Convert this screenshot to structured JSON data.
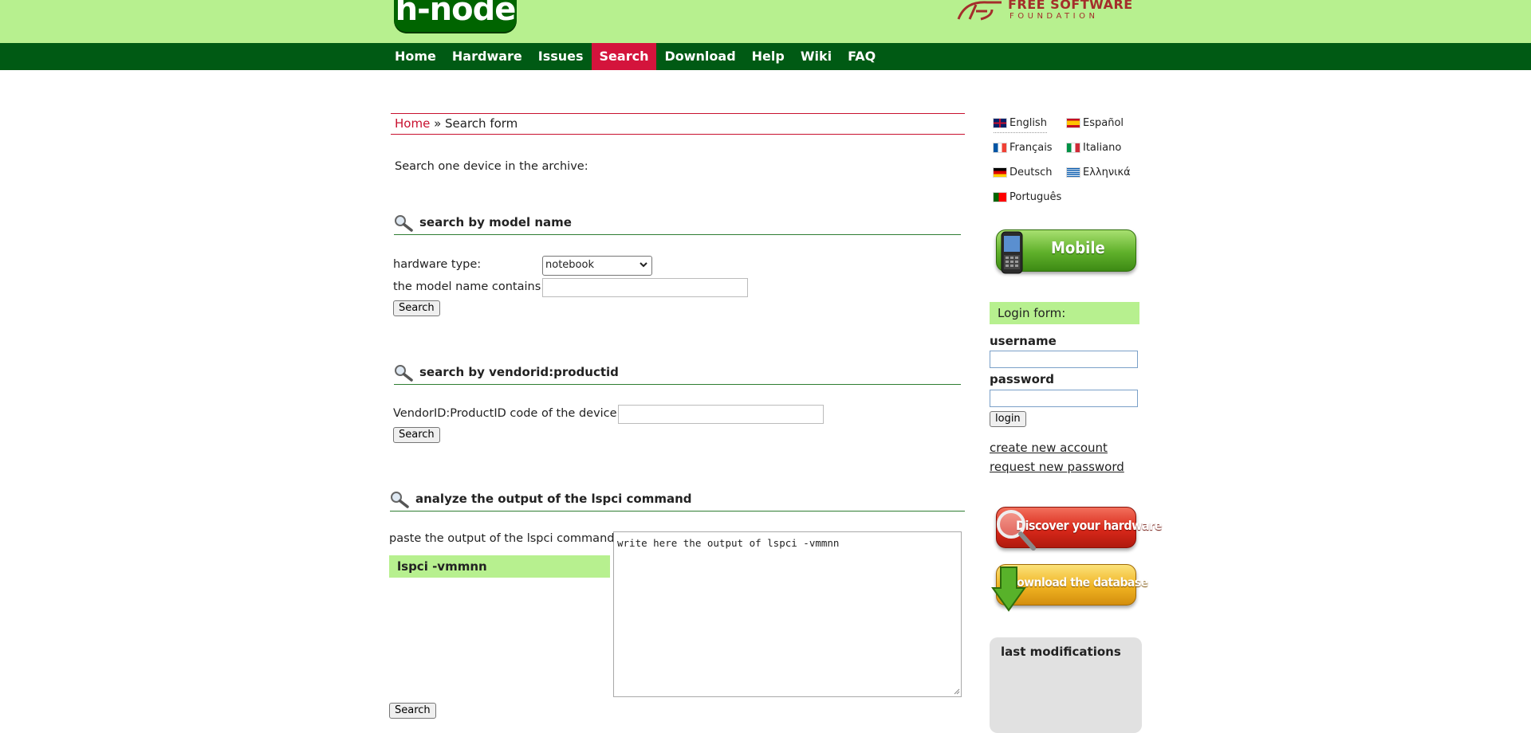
{
  "header": {
    "logo_text": "h-node",
    "fsf_line1": "FREE SOFTWARE",
    "fsf_line2": "FOUNDATION",
    "fsf_color": "#a42e2b",
    "banner_color": "#b7f08f"
  },
  "menu": {
    "items": [
      {
        "label": "Home"
      },
      {
        "label": "Hardware"
      },
      {
        "label": "Issues"
      },
      {
        "label": "Search",
        "active": true
      },
      {
        "label": "Download"
      },
      {
        "label": "Help"
      },
      {
        "label": "Wiki"
      },
      {
        "label": "FAQ"
      }
    ],
    "bar_color": "#005a14",
    "active_color": "#d4143c"
  },
  "breadcrumb": {
    "home": "Home",
    "sep": " » ",
    "current": "Search form"
  },
  "intro": "Search one device in the archive:",
  "model_search": {
    "title": "search by model name",
    "type_label": "hardware type:",
    "type_value": "notebook",
    "name_label": "the model name contains:",
    "name_value": "",
    "button": "Search"
  },
  "vendor_search": {
    "title": "search by vendorid:productid",
    "code_label": "VendorID:ProductID code of the device:",
    "code_value": "",
    "button": "Search"
  },
  "lspci_search": {
    "title": "analyze the output of the lspci command",
    "paste_label": "paste the output of the lspci command:",
    "command": "lspci -vmmnn",
    "textarea_value": "write here the output of lspci -vmmnn",
    "button": "Search"
  },
  "languages": [
    {
      "label": "English",
      "flag": "gb-flag-icon"
    },
    {
      "label": "Español",
      "flag": "es-flag-icon"
    },
    {
      "label": "Français",
      "flag": "fr-flag-icon"
    },
    {
      "label": "Italiano",
      "flag": "it-flag-icon"
    },
    {
      "label": "Deutsch",
      "flag": "de-flag-icon"
    },
    {
      "label": "Ελληνικά",
      "flag": "gr-flag-icon"
    },
    {
      "label": "Português",
      "flag": "pt-flag-icon"
    }
  ],
  "mobile_button": "Mobile",
  "login": {
    "title": "Login form:",
    "username_label": "username",
    "username_value": "",
    "password_label": "password",
    "password_value": "",
    "button": "login",
    "create_account": "create new account",
    "request_password": "request new password"
  },
  "discover_button": "Discover your hardware",
  "download_button": "Download the database",
  "last_modifications": "last modifications"
}
